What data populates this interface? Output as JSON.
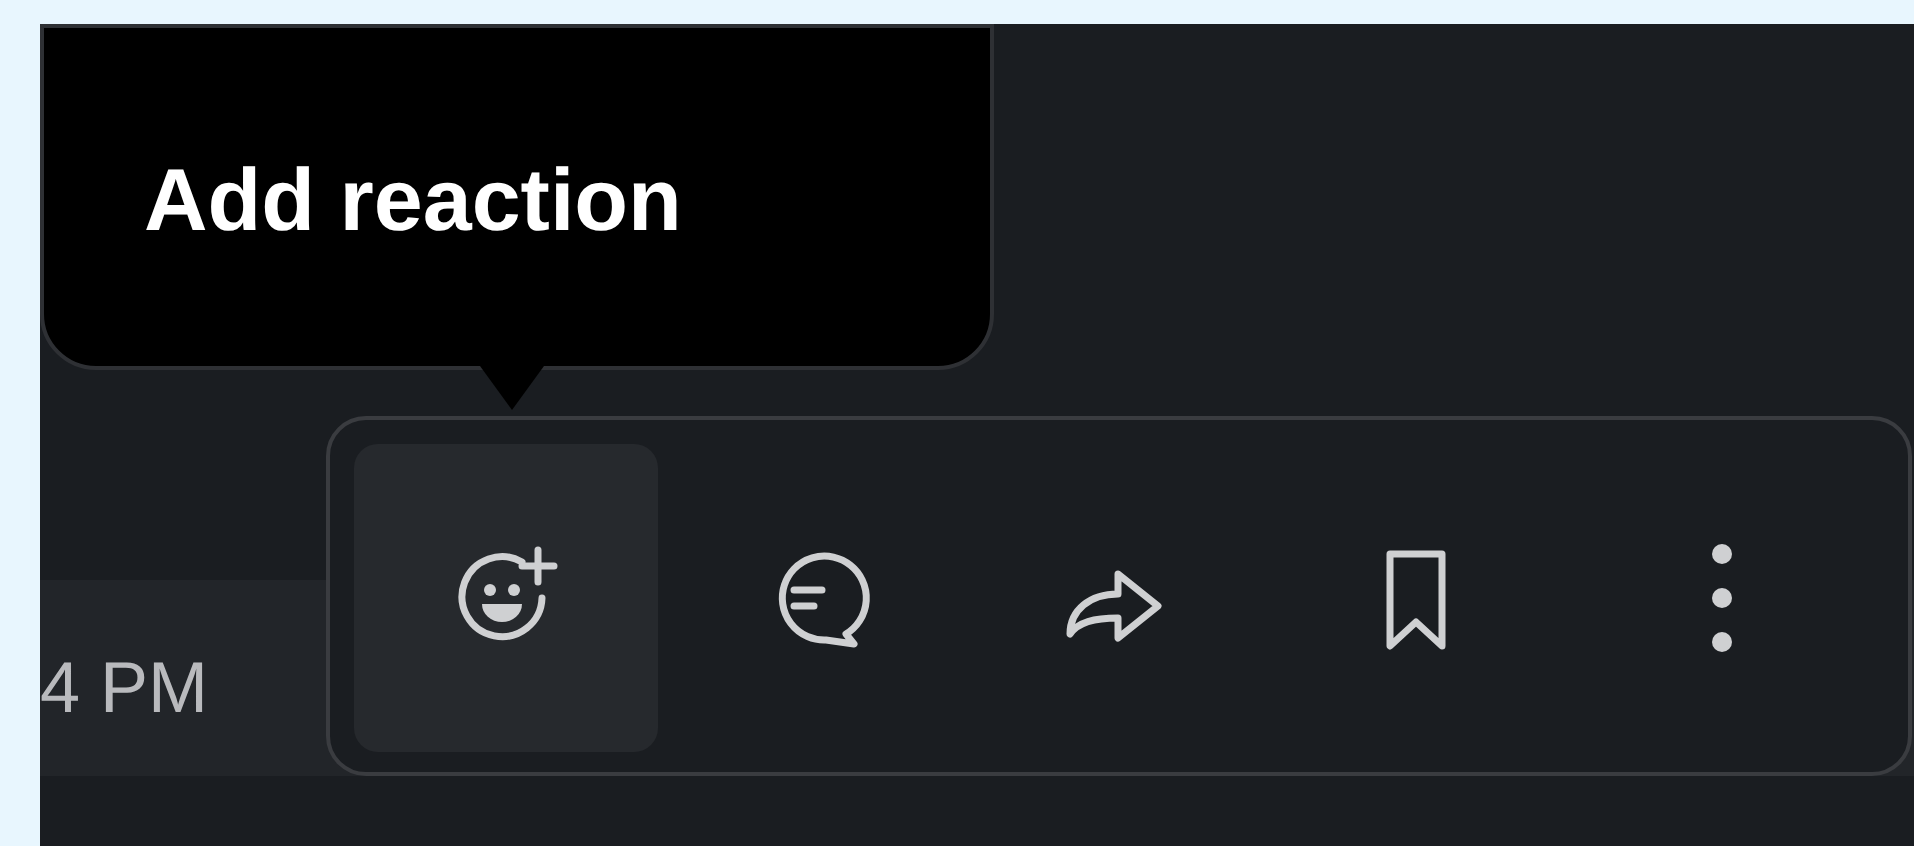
{
  "tooltip": {
    "text": "Add reaction"
  },
  "message": {
    "timestamp": "4 PM"
  },
  "actions": [
    {
      "kind": "reaction",
      "hovered": true
    },
    {
      "kind": "thread",
      "hovered": false
    },
    {
      "kind": "share",
      "hovered": false
    },
    {
      "kind": "save",
      "hovered": false
    },
    {
      "kind": "more",
      "hovered": false
    }
  ]
}
